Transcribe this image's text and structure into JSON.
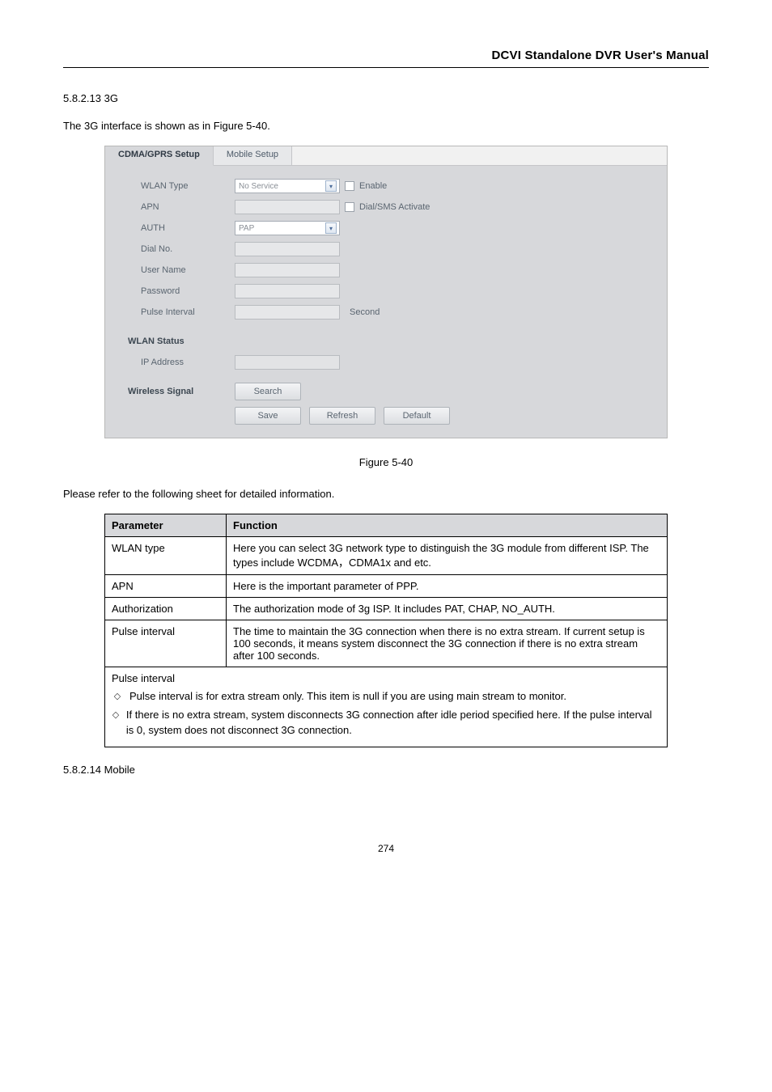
{
  "header": {
    "title": "DCVI Standalone DVR User's Manual"
  },
  "intro": {
    "line1": "5.8.2.13 3G",
    "line2_a": "The 3G interface is shown as in ",
    "line2_b": "Figure 5-40",
    "line2_c": "."
  },
  "screenshot": {
    "tabs": {
      "active": "CDMA/GPRS Setup",
      "other": "Mobile Setup"
    },
    "rows": {
      "wlan_type": {
        "label": "WLAN Type",
        "value": "No Service",
        "check_label": "Enable"
      },
      "apn": {
        "label": "APN",
        "check_label": "Dial/SMS Activate"
      },
      "auth": {
        "label": "AUTH",
        "value": "PAP"
      },
      "dial_no": {
        "label": "Dial No."
      },
      "user_name": {
        "label": "User Name"
      },
      "password": {
        "label": "Password"
      },
      "pulse_interval": {
        "label": "Pulse Interval",
        "unit": "Second"
      },
      "wlan_status": {
        "label": "WLAN Status"
      },
      "ip_address": {
        "label": "IP Address"
      },
      "wireless_signal": {
        "label": "Wireless Signal"
      }
    },
    "buttons": {
      "search": "Search",
      "save": "Save",
      "refresh": "Refresh",
      "default": "Default"
    }
  },
  "caption": "Figure 5-40",
  "table_intro": "Please refer to the following sheet for detailed information.",
  "table": {
    "header": {
      "c1": "Parameter",
      "c2": "Function"
    },
    "rows": [
      {
        "c1": "WLAN type",
        "c2": "Here you can select 3G network type to distinguish the 3G module from different ISP. The types include WCDMA，CDMA1x and etc."
      },
      {
        "c1": "APN",
        "c2": "Here is the important parameter of PPP."
      },
      {
        "c1": "Authorization",
        "c2": "The authorization mode of 3g ISP. It includes PAT, CHAP, NO_AUTH."
      },
      {
        "c1": "Pulse interval",
        "c2": "The time to maintain the 3G connection when there is no extra stream. If current setup is 100 seconds, it means system disconnect the 3G connection if there is no extra stream after 100 seconds."
      },
      {
        "merged": true,
        "intro": "Pulse interval",
        "items": [
          "Pulse interval is for extra stream only. This item is null if you are using main stream to monitor.",
          "If there is no extra stream, system disconnects 3G connection after idle period specified here. If the pulse interval is 0, system does not disconnect 3G connection."
        ]
      }
    ]
  },
  "mobile_section": "5.8.2.14 Mobile",
  "footer": "274"
}
